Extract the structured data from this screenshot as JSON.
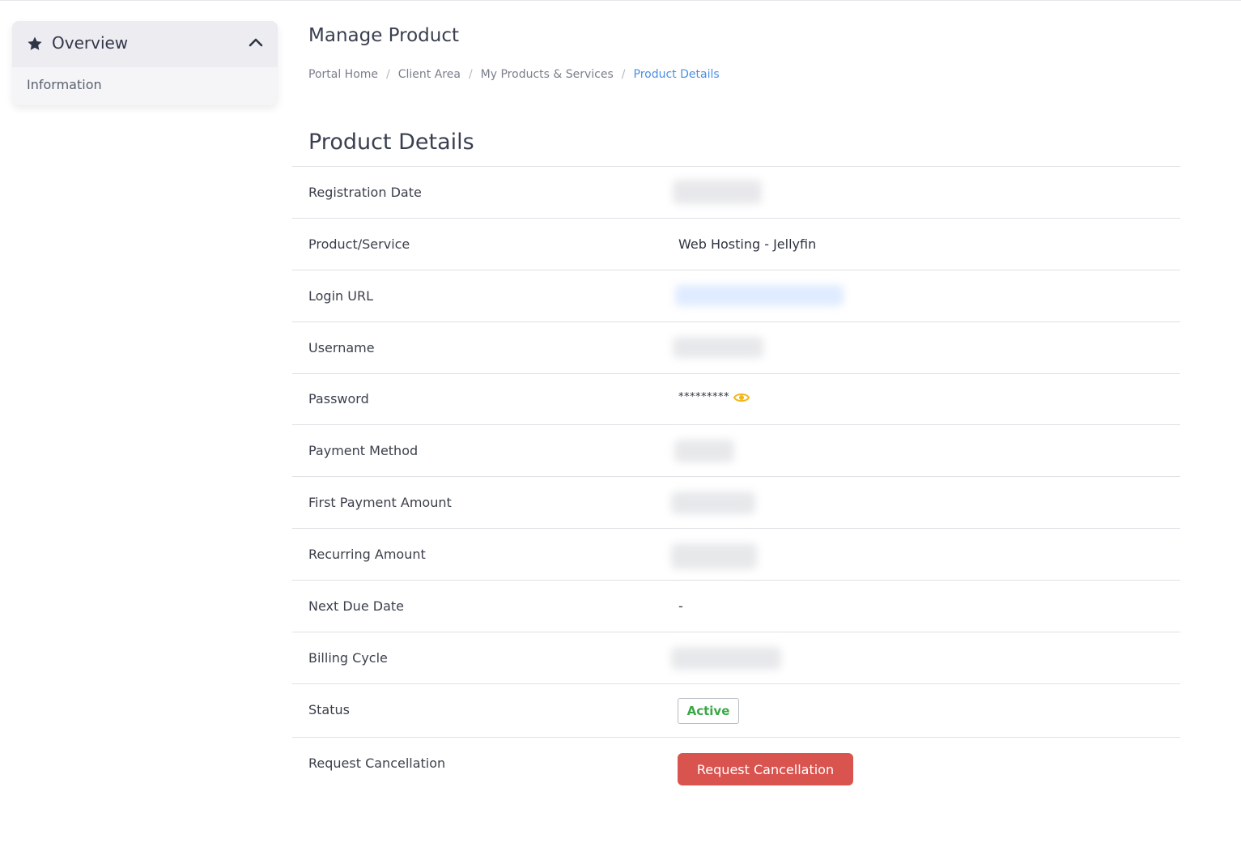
{
  "sidebar": {
    "header_title": "Overview",
    "items": [
      {
        "label": "Information"
      }
    ]
  },
  "page": {
    "title": "Manage Product",
    "breadcrumb": [
      "Portal Home",
      "Client Area",
      "My Products & Services",
      "Product Details"
    ],
    "breadcrumb_separator": "/"
  },
  "details": {
    "section_title": "Product Details",
    "rows": [
      {
        "label": "Registration Date",
        "value": ""
      },
      {
        "label": "Product/Service",
        "value": "Web Hosting - Jellyfin"
      },
      {
        "label": "Login URL",
        "value": ""
      },
      {
        "label": "Username",
        "value": ""
      },
      {
        "label": "Password",
        "value": "*********"
      },
      {
        "label": "Payment Method",
        "value": ""
      },
      {
        "label": "First Payment Amount",
        "value": ""
      },
      {
        "label": "Recurring Amount",
        "value": ""
      },
      {
        "label": "Next Due Date",
        "value": "-"
      },
      {
        "label": "Billing Cycle",
        "value": ""
      },
      {
        "label": "Status",
        "value": "Active"
      },
      {
        "label": "Request Cancellation",
        "button_label": "Request Cancellation"
      }
    ]
  },
  "colors": {
    "accent_link": "#4a90e2",
    "status_active": "#3aa847",
    "danger_button": "#d9534f",
    "eye_icon": "#f2b619"
  },
  "icons": {
    "sidebar_header": "star-icon",
    "collapse": "chevron-up-icon",
    "reveal_password": "eye-icon"
  }
}
